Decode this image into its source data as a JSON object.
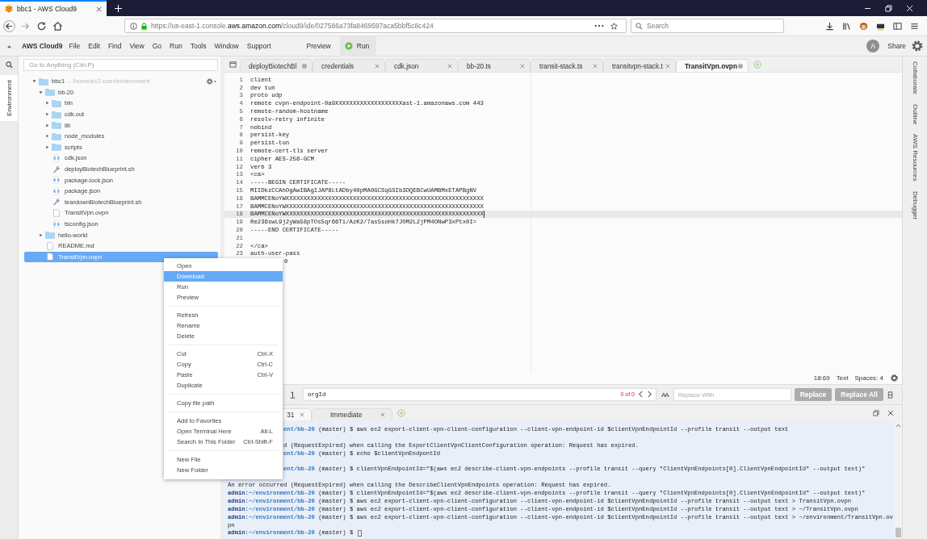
{
  "browser": {
    "tab_title": "bbc1 - AWS Cloud9",
    "url_prefix": "https://us-east-1.console.",
    "url_domain": "aws.amazon.com",
    "url_path": "/cloud9/ide/027586a73fa8469597aca5bbf5c8c424",
    "search_placeholder": "Search"
  },
  "menubar": {
    "brand": "AWS Cloud9",
    "menus": [
      "File",
      "Edit",
      "Find",
      "View",
      "Go",
      "Run",
      "Tools",
      "Window",
      "Support"
    ],
    "preview": "Preview",
    "run": "Run",
    "avatar": "A",
    "share": "Share"
  },
  "sidebar": {
    "rail_label": "Environment",
    "search_placeholder": "Go to Anything (Ctrl-P)",
    "tree": [
      {
        "name": "bbc1",
        "path": "- /home/ec2-user/environment",
        "kind": "folder",
        "expanded": true,
        "selected": false,
        "children": [
          {
            "name": "bb-20",
            "kind": "folder",
            "expanded": true,
            "selected": false,
            "children": [
              {
                "name": "bin",
                "kind": "folder",
                "expanded": false,
                "selected": false
              },
              {
                "name": "cdk.out",
                "kind": "folder",
                "expanded": false,
                "selected": false
              },
              {
                "name": "lib",
                "kind": "folder",
                "expanded": false,
                "selected": false
              },
              {
                "name": "node_modules",
                "kind": "folder",
                "expanded": false,
                "selected": false
              },
              {
                "name": "scripts",
                "kind": "folder",
                "expanded": false,
                "selected": false
              },
              {
                "name": "cdk.json",
                "kind": "json",
                "selected": false
              },
              {
                "name": "deployBiotechBlueprint.sh",
                "kind": "script",
                "selected": false
              },
              {
                "name": "package-lock.json",
                "kind": "json",
                "selected": false
              },
              {
                "name": "package.json",
                "kind": "json",
                "selected": false
              },
              {
                "name": "teardownBiotechBlueprint.sh",
                "kind": "script",
                "selected": false
              },
              {
                "name": "TransitVpn.ovpn",
                "kind": "file",
                "selected": false
              },
              {
                "name": "tsconfig.json",
                "kind": "json",
                "selected": false
              }
            ]
          },
          {
            "name": "hello-world",
            "kind": "folder",
            "expanded": false,
            "selected": false
          },
          {
            "name": "README.md",
            "kind": "file",
            "selected": false
          },
          {
            "name": "TransitVpn.ovpn",
            "kind": "file",
            "selected": true
          }
        ]
      }
    ]
  },
  "context_menu": {
    "groups": [
      [
        {
          "label": "Open",
          "selected": false
        },
        {
          "label": "Download",
          "selected": true
        },
        {
          "label": "Run",
          "selected": false
        },
        {
          "label": "Preview",
          "selected": false
        }
      ],
      [
        {
          "label": "Refresh",
          "selected": false
        },
        {
          "label": "Rename",
          "selected": false
        },
        {
          "label": "Delete",
          "selected": false
        }
      ],
      [
        {
          "label": "Cut",
          "shortcut": "Ctrl-X",
          "selected": false
        },
        {
          "label": "Copy",
          "shortcut": "Ctrl-C",
          "selected": false
        },
        {
          "label": "Paste",
          "shortcut": "Ctrl-V",
          "selected": false
        },
        {
          "label": "Duplicate",
          "selected": false
        }
      ],
      [
        {
          "label": "Copy file path",
          "selected": false
        }
      ],
      [
        {
          "label": "Add to Favorites",
          "selected": false
        },
        {
          "label": "Open Terminal Here",
          "shortcut": "Alt-L",
          "selected": false
        },
        {
          "label": "Search In This Folder",
          "shortcut": "Ctrl-Shift-F",
          "selected": false
        }
      ],
      [
        {
          "label": "New File",
          "selected": false
        },
        {
          "label": "New Folder",
          "selected": false
        }
      ]
    ]
  },
  "editor": {
    "tabs": [
      {
        "label": "deployBiotechBl",
        "unsaved": true,
        "selected": false
      },
      {
        "label": "credentials",
        "unsaved": false,
        "selected": false
      },
      {
        "label": "cdk.json",
        "unsaved": false,
        "selected": false
      },
      {
        "label": "bb-20.ts",
        "unsaved": false,
        "selected": false
      },
      {
        "label": "transit-stack.ts",
        "unsaved": false,
        "selected": false
      },
      {
        "label": "transitvpn-stack.t",
        "unsaved": false,
        "selected": false
      },
      {
        "label": "TransitVpn.ovpn",
        "unsaved": true,
        "selected": true
      }
    ],
    "lines": [
      {
        "num": "1",
        "text": "client",
        "active": false,
        "covered": false
      },
      {
        "num": "2",
        "text": "dev tun",
        "active": false,
        "covered": false
      },
      {
        "num": "3",
        "text": "proto udp",
        "active": false,
        "covered": false
      },
      {
        "num": "4",
        "text": "remote cvpn-endpoint-0a9XXXXXXXXXXXXXXXXXXXast-1.amazonaws.com 443",
        "active": false,
        "covered": false
      },
      {
        "num": "5",
        "text": "remote-random-hostname",
        "active": false,
        "covered": false
      },
      {
        "num": "6",
        "text": "resolv-retry infinite",
        "active": false,
        "covered": false
      },
      {
        "num": "7",
        "text": "nobind",
        "active": false,
        "covered": false
      },
      {
        "num": "8",
        "text": "persist-key",
        "active": false,
        "covered": false
      },
      {
        "num": "9",
        "text": "persist-tun",
        "active": false,
        "covered": false
      },
      {
        "num": "10",
        "text": "remote-cert-tls server",
        "active": false,
        "covered": false
      },
      {
        "num": "11",
        "text": "cipher AES-256-GCM",
        "active": false,
        "covered": false
      },
      {
        "num": "12",
        "text": "verb 3",
        "active": false,
        "covered": false
      },
      {
        "num": "13",
        "text": "<ca>",
        "active": false,
        "covered": false
      },
      {
        "num": "14",
        "text": "-----BEGIN CERTIFICATE-----",
        "active": false,
        "covered": false
      },
      {
        "num": "15",
        "text": "MIIDkzCCAhOgAwIBAgIJAP8LtADby40pMA0GCSqGSIb3DQEBCwUAMBMxETAPBgNV",
        "active": false,
        "covered": false
      },
      {
        "num": "16",
        "text": "BAMMCENoYWXXXXXXXXXXXXXXXXXXXXXXXXXXXXXXXXXXXXXXXXXXXXXXXXXXXXXXXX",
        "active": false,
        "covered": false
      },
      {
        "num": "17",
        "text": "BAMMCENoYWXXXXXXXXXXXXXXXXXXXXXXXXXXXXXXXXXXXXXXXXXXXXXXXXXXXXXXXX",
        "active": false,
        "covered": false
      },
      {
        "num": "18",
        "text": "BAMMCENoYWXXXXXXXXXXXXXXXXXXXXXXXXXXXXXXXXXXXXXXXXXXXXXXXXXXXXXXXX",
        "active": true,
        "covered": false
      },
      {
        "num": "19",
        "text": "Re236swL9j2yWa58pTOs5qr66Ti/AzK2/7as5soHk7JOM2L2jPM4ONwP3xPtx0I=",
        "active": false,
        "covered": false
      },
      {
        "num": "20",
        "text": "-----END CERTIFICATE-----",
        "active": false,
        "covered": false
      },
      {
        "num": "21",
        "active": false
      },
      {
        "num": "22",
        "text": "</ca>",
        "active": false,
        "covered": false
      },
      {
        "num": "23",
        "text": "auth-user-pass",
        "active": false,
        "covered": false
      },
      {
        "text": "0",
        "active": false,
        "covered": true
      }
    ],
    "status": {
      "position": "18:69",
      "mode": "Text",
      "indent": "Spaces: 4"
    }
  },
  "find_bar": {
    "find_value": "orgId",
    "match_count": "0 of 0",
    "aa": "AA",
    "replace_placeholder": "Replace With",
    "replace": "Replace",
    "replace_all": "Replace All"
  },
  "console": {
    "tabs": [
      {
        "label": "31",
        "selected": true,
        "covered": true
      },
      {
        "label": "Immediate",
        "selected": false,
        "covered": false
      }
    ],
    "lines": [
      {
        "kind": "cmd",
        "covered": true,
        "path": "ent/bb-20",
        "branch": "(master) $",
        "command": "aws ec2 export-client-vpn-client-configuration --client-vpn-endpoint-id $clientVpnEndpointId --profile transit --output text"
      },
      {
        "kind": "blank"
      },
      {
        "kind": "out",
        "covered": true,
        "text": "d (RequestExpired) when calling the ExportClientVpnClientConfiguration operation: Request has expired."
      },
      {
        "kind": "cmd",
        "covered": true,
        "path": "ent/bb-20",
        "branch": "(master) $",
        "command": "echo $clientVpnEndpontId"
      },
      {
        "kind": "blank"
      },
      {
        "kind": "cmd",
        "covered": true,
        "path": "ent/bb-20",
        "branch": "(master) $",
        "command": "clientVpnEndpointId=\"$(aws ec2 describe-client-vpn-endpoints --profile transit --query \"ClientVpnEndpoints[0].ClientVpnEndpointId\" --output text)\""
      },
      {
        "kind": "blank"
      },
      {
        "kind": "out",
        "covered": false,
        "text": "An error occurred (RequestExpired) when calling the DescribeClientVpnEndpoints operation: Request has expired."
      },
      {
        "kind": "cmd",
        "covered": false,
        "user": "admin:",
        "path": "~/environment/bb-20",
        "branch": "(master) $",
        "command": "clientVpnEndpointId=\"$(aws ec2 describe-client-vpn-endpoints --profile transit --query \"ClientVpnEndpoints[0].ClientVpnEndpointId\" --output text)\""
      },
      {
        "kind": "cmd",
        "covered": false,
        "user": "admin:",
        "path": "~/environment/bb-20",
        "branch": "(master) $",
        "command": "aws ec2 export-client-vpn-client-configuration --client-vpn-endpoint-id $clientVpnEndpointId --profile transit --output text > TransitVpn.ovpn"
      },
      {
        "kind": "cmd",
        "covered": false,
        "user": "admin:",
        "path": "~/environment/bb-20",
        "branch": "(master) $",
        "command": "aws ec2 export-client-vpn-client-configuration --client-vpn-endpoint-id $clientVpnEndpointId --profile transit --output text > ~/TransitVpn.ovpn"
      },
      {
        "kind": "cmd",
        "covered": false,
        "user": "admin:",
        "path": "~/environment/bb-20",
        "branch": "(master) $",
        "command": "aws ec2 export-client-vpn-client-configuration --client-vpn-endpoint-id $clientVpnEndpointId --profile transit --output text > ~/environment/TransitVpn.ov"
      },
      {
        "kind": "out",
        "covered": false,
        "text": "pn"
      },
      {
        "kind": "prompt",
        "covered": false,
        "user": "admin:",
        "path": "~/environment/bb-20",
        "branch": "(master) $"
      }
    ]
  },
  "right_rail": [
    "Collaborate",
    "Outline",
    "AWS Resources",
    "Debugger"
  ]
}
